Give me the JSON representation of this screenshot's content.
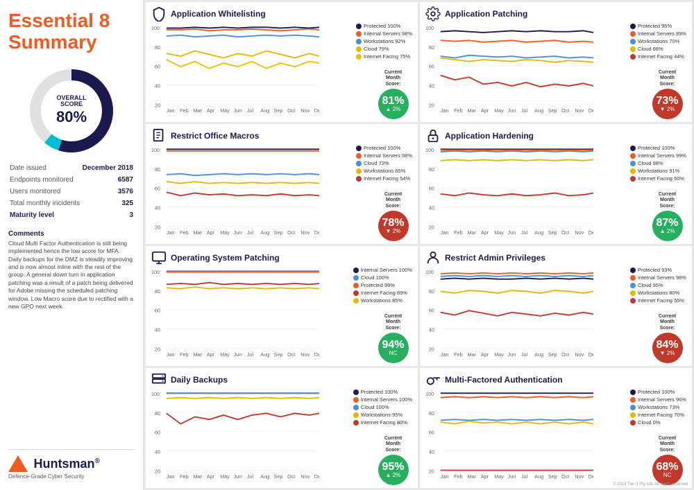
{
  "left": {
    "title": "Essential 8\nSummary",
    "overall_label": "OVERALL\nSCORE",
    "overall_percent": "80%",
    "donut_score": 80,
    "stats": [
      {
        "label": "Date issued",
        "value": "December 2018"
      },
      {
        "label": "Endpoints monitored",
        "value": "6587"
      },
      {
        "label": "Users monitored",
        "value": "3576"
      },
      {
        "label": "Total monthly incidents",
        "value": "325"
      },
      {
        "label": "Maturity level",
        "value": "3"
      }
    ],
    "comments_title": "Comments",
    "comments": "Cloud Multi Factor Authentication is still being implemented hence the low score for MFA. Daily backups for the DMZ is steadily improving and is now almost inline with the rest of the group. A general down turn in application patching was a result of a patch being delivered for Adobe missing the scheduled patching window. Low Macro score due to rectified with a new GPO next week.",
    "logo_text": "Huntsman",
    "logo_tagline": "Defence-Grade Cyber Security",
    "copyright": "© 2019 Tier-3 Pty Ltd. All rights reserved"
  },
  "charts": [
    {
      "id": "app-whitelisting",
      "title": "Application Whitelisting",
      "icon": "shield",
      "legend": [
        {
          "label": "Protected 100%",
          "color": "#1a1a4e"
        },
        {
          "label": "Internal Servers 98%",
          "color": "#f15a22"
        },
        {
          "label": "Workstations 92%",
          "color": "#4a90d9"
        },
        {
          "label": "Cloud 79%",
          "color": "#f0c000"
        },
        {
          "label": "Internet Facing 75%",
          "color": "#f0c000"
        }
      ],
      "score": "81%",
      "score_change": "▲ 2%",
      "score_color": "green",
      "score_label": "Current\nMonth\nScore:"
    },
    {
      "id": "app-patching",
      "title": "Application Patching",
      "icon": "gear",
      "legend": [
        {
          "label": "Protected 95%",
          "color": "#1a1a4e"
        },
        {
          "label": "Internal Servers 89%",
          "color": "#f15a22"
        },
        {
          "label": "Workstations 70%",
          "color": "#4a90d9"
        },
        {
          "label": "Cloud 68%",
          "color": "#f0c000"
        },
        {
          "label": "Internet Facing 44%",
          "color": "#c0392b"
        }
      ],
      "score": "73%",
      "score_change": "▼ 2%",
      "score_color": "red",
      "score_label": "Current\nMonth\nScore:"
    },
    {
      "id": "restrict-macros",
      "title": "Restrict Office Macros",
      "icon": "document",
      "legend": [
        {
          "label": "Protected 100%",
          "color": "#1a1a4e"
        },
        {
          "label": "Internal Servers 98%",
          "color": "#f15a22"
        },
        {
          "label": "Cloud 72%",
          "color": "#4a90d9"
        },
        {
          "label": "Workstations 65%",
          "color": "#f0c000"
        },
        {
          "label": "Internet Facing 54%",
          "color": "#c0392b"
        }
      ],
      "score": "78%",
      "score_change": "▼ 2%",
      "score_color": "red",
      "score_label": "Current\nMonth\nScore:"
    },
    {
      "id": "app-hardening",
      "title": "Application Hardening",
      "icon": "lock",
      "legend": [
        {
          "label": "Protected 100%",
          "color": "#1a1a4e"
        },
        {
          "label": "Internal Servers 99%",
          "color": "#f15a22"
        },
        {
          "label": "Cloud 98%",
          "color": "#4a90d9"
        },
        {
          "label": "Workstations 91%",
          "color": "#f0c000"
        },
        {
          "label": "Internet Facing 50%",
          "color": "#c0392b"
        }
      ],
      "score": "87%",
      "score_change": "▲ 2%",
      "score_color": "green",
      "score_label": "Current\nMonth\nScore:"
    },
    {
      "id": "os-patching",
      "title": "Operating System Patching",
      "icon": "monitor",
      "legend": [
        {
          "label": "Internal Servers 100%",
          "color": "#1a1a4e"
        },
        {
          "label": "Cloud 100%",
          "color": "#4a90d9"
        },
        {
          "label": "Protected 99%",
          "color": "#f15a22"
        },
        {
          "label": "Internet Facing 89%",
          "color": "#c0392b"
        },
        {
          "label": "Workstations 85%",
          "color": "#f0c000"
        }
      ],
      "score": "94%",
      "score_change": "NC",
      "score_color": "green",
      "score_label": "Current\nMonth\nScore:"
    },
    {
      "id": "restrict-admin",
      "title": "Restrict Admin Privileges",
      "icon": "person",
      "legend": [
        {
          "label": "Protected 93%",
          "color": "#1a1a4e"
        },
        {
          "label": "Internal Servers 98%",
          "color": "#f15a22"
        },
        {
          "label": "Cloud 95%",
          "color": "#4a90d9"
        },
        {
          "label": "Workstations 80%",
          "color": "#f0c000"
        },
        {
          "label": "Internet Facing 55%",
          "color": "#c0392b"
        }
      ],
      "score": "84%",
      "score_change": "▼ 2%",
      "score_color": "red",
      "score_label": "Current\nMonth\nScore:"
    },
    {
      "id": "daily-backups",
      "title": "Daily Backups",
      "icon": "server",
      "legend": [
        {
          "label": "Protected 100%",
          "color": "#1a1a4e"
        },
        {
          "label": "Internal Servers 100%",
          "color": "#f15a22"
        },
        {
          "label": "Cloud 100%",
          "color": "#4a90d9"
        },
        {
          "label": "Workstations 95%",
          "color": "#f0c000"
        },
        {
          "label": "Internet Facing 80%",
          "color": "#c0392b"
        }
      ],
      "score": "95%",
      "score_change": "▲ 2%",
      "score_color": "green",
      "score_label": "Current\nMonth\nScore:"
    },
    {
      "id": "mfa",
      "title": "Multi-Factored Authentication",
      "icon": "key",
      "legend": [
        {
          "label": "Protected 100%",
          "color": "#1a1a4e"
        },
        {
          "label": "Internal Servers 96%",
          "color": "#f15a22"
        },
        {
          "label": "Workstations 73%",
          "color": "#4a90d9"
        },
        {
          "label": "Internet Facing 70%",
          "color": "#f0c000"
        },
        {
          "label": "Cloud 0%",
          "color": "#c0392b"
        }
      ],
      "score": "68%",
      "score_change": "NC",
      "score_color": "red",
      "score_label": "Current\nMonth\nScore:"
    }
  ],
  "months": [
    "Jan",
    "Feb",
    "Mar",
    "Apr",
    "May",
    "Jun",
    "Jul",
    "Aug",
    "Sep",
    "Oct",
    "Nov",
    "Dec"
  ]
}
